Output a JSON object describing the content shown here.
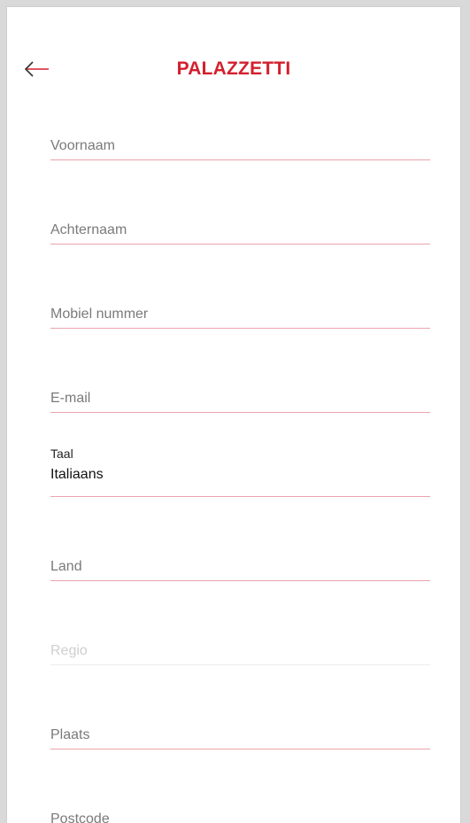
{
  "header": {
    "brand": "PALAZZETTI",
    "back_icon": "arrow-left-icon"
  },
  "colors": {
    "brand_red": "#d31f2d",
    "underline": "#e9a4aa",
    "label_gray": "#7a7a7a",
    "disabled_gray": "#cfcfcf"
  },
  "form": {
    "first_name": {
      "placeholder": "Voornaam"
    },
    "last_name": {
      "placeholder": "Achternaam"
    },
    "mobile": {
      "placeholder": "Mobiel nummer"
    },
    "email": {
      "placeholder": "E-mail"
    },
    "language": {
      "label": "Taal",
      "value": "Italiaans"
    },
    "country": {
      "placeholder": "Land"
    },
    "region": {
      "placeholder": "Regio"
    },
    "city": {
      "placeholder": "Plaats"
    },
    "postal_code": {
      "placeholder": "Postcode"
    }
  }
}
